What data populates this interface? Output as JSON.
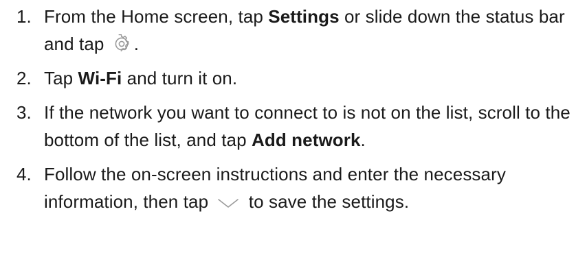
{
  "steps": [
    {
      "number": "1.",
      "text_a": "From the Home screen, tap ",
      "bold_a": "Settings",
      "text_b": " or slide down the status bar and tap",
      "icon": "gear-icon",
      "text_c": "."
    },
    {
      "number": "2.",
      "text_a": "Tap ",
      "bold_a": "Wi-Fi",
      "text_b": " and turn it on."
    },
    {
      "number": "3.",
      "text_a": "If the network you want to connect to is not on the list, scroll to the bottom of the list, and tap ",
      "bold_a": "Add network",
      "text_b": "."
    },
    {
      "number": "4.",
      "text_a": "Follow the on-screen instructions and enter the necessary information, then tap",
      "icon": "checkmark-icon",
      "text_b": "to save the settings."
    }
  ],
  "colors": {
    "text": "#1a1a1a",
    "icon": "#9a9a9a"
  }
}
